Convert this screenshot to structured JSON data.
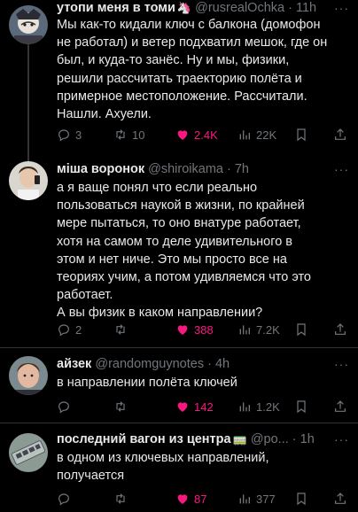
{
  "tweets": [
    {
      "name": "утопи меня в томи",
      "emoji": "🦄",
      "handle": "@rusrealOchka",
      "time": "· 11h",
      "lines": [
        "Мы как-то кидали ключ с балкона (домофон",
        "не работал) и ветер подхватил мешок, где он",
        "был, и куда-то занёс. Ну и мы, физики,",
        "решили рассчитать траекторию полёта и",
        "примерное местоположение. Рассчитали.",
        "Нашли. Ахуели."
      ],
      "replies": "3",
      "retweets": "10",
      "likes": "2.4K",
      "views": "22K",
      "liked": true
    },
    {
      "name": "міша воронок",
      "emoji": "",
      "handle": "@shiroikama",
      "time": "· 7h",
      "lines": [
        "а я ваще понял что если реально",
        "пользоваться наукой в жизни, по крайней",
        "мере пытаться, то оно внатуре работает,",
        "хотя на самом то деле удивительного в",
        "этом и нет ниче. Это мы просто все на",
        "теориях учим, а потом удивляемся что это",
        "работает.",
        "А вы физик в каком направлении?"
      ],
      "replies": "2",
      "retweets": "",
      "likes": "388",
      "views": "7.2K",
      "liked": true
    },
    {
      "name": "айзек",
      "emoji": "",
      "handle": "@randomguynotes",
      "time": "· 4h",
      "lines": [
        "в направлении полёта ключей"
      ],
      "replies": "",
      "retweets": "",
      "likes": "142",
      "views": "1.2K",
      "liked": true
    },
    {
      "name": "последний вагон из центра",
      "emoji": "🚃",
      "handle": "@po...",
      "time": "· 1h",
      "lines": [
        "в одном из ключевых направлений,",
        "получается"
      ],
      "replies": "",
      "retweets": "",
      "likes": "87",
      "views": "377",
      "liked": true
    }
  ],
  "more_label": "···",
  "colors": {
    "background": "#000000",
    "text": "#e7e9ea",
    "secondary": "#71767b",
    "like": "#f91880",
    "divider": "#2f3336"
  },
  "icons": [
    "reply-icon",
    "retweet-icon",
    "heart-icon",
    "views-icon",
    "bookmark-icon",
    "share-icon",
    "more-icon"
  ]
}
